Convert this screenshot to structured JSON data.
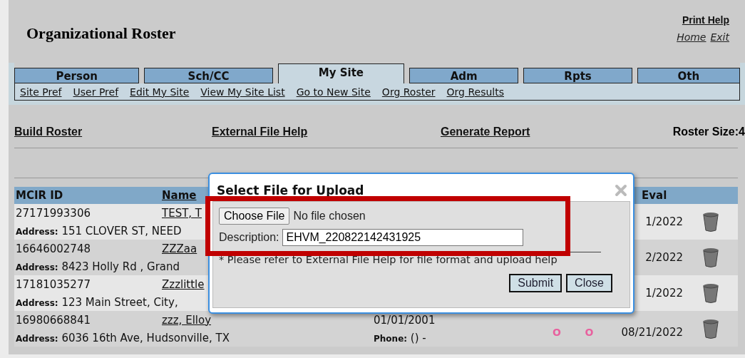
{
  "header": {
    "title": "Organizational Roster",
    "print_help": "Print Help",
    "links": [
      "Home",
      "Exit"
    ]
  },
  "tabs": [
    {
      "label": "Person",
      "selected": false
    },
    {
      "label": "Sch/CC",
      "selected": false
    },
    {
      "label": "My Site",
      "selected": true
    },
    {
      "label": "Adm",
      "selected": false
    },
    {
      "label": "Rpts",
      "selected": false
    },
    {
      "label": "Oth",
      "selected": false
    }
  ],
  "subnav": [
    "Site Pref",
    "User Pref",
    "Edit My Site",
    "View My Site List",
    "Go to New Site",
    "Org Roster",
    "Org Results"
  ],
  "actions": [
    "Build Roster",
    "External File Help",
    "Generate Report"
  ],
  "roster_size": "Roster Size:4",
  "table": {
    "columns": [
      "MCIR ID",
      "Name",
      "Eval"
    ],
    "rows": [
      {
        "id": "27171993306",
        "name": "TEST, T",
        "address_label": "Address:",
        "address": "151 CLOVER ST, NEED",
        "eval": "1/2022"
      },
      {
        "id": "16646002748",
        "name": "ZZZaa",
        "address_label": "Address:",
        "address": "8423 Holly Rd , Grand",
        "eval": "2/2022"
      },
      {
        "id": "17181035277",
        "name": "Zzzlittle",
        "address_label": "Address:",
        "address": "123 Main Street, City,",
        "eval": "1/2022"
      },
      {
        "id": "16980668841",
        "name": "zzz, Elloy",
        "address_label": "Address:",
        "address": "6036 16th Ave, Hudsonville, TX",
        "dob": "01/01/2001",
        "phone_label": "Phone:",
        "phone": "() -",
        "marks": [
          "O",
          "O"
        ],
        "eval": "08/21/2022"
      }
    ]
  },
  "dialog": {
    "title": "Select File for Upload",
    "choose_button": "Choose File",
    "file_status": "No file chosen",
    "description_label": "Description:",
    "description_value": "EHVM_220822142431925",
    "note": "* Please refer to External File Help for file format and upload help",
    "buttons": [
      "Submit",
      "Close"
    ]
  }
}
